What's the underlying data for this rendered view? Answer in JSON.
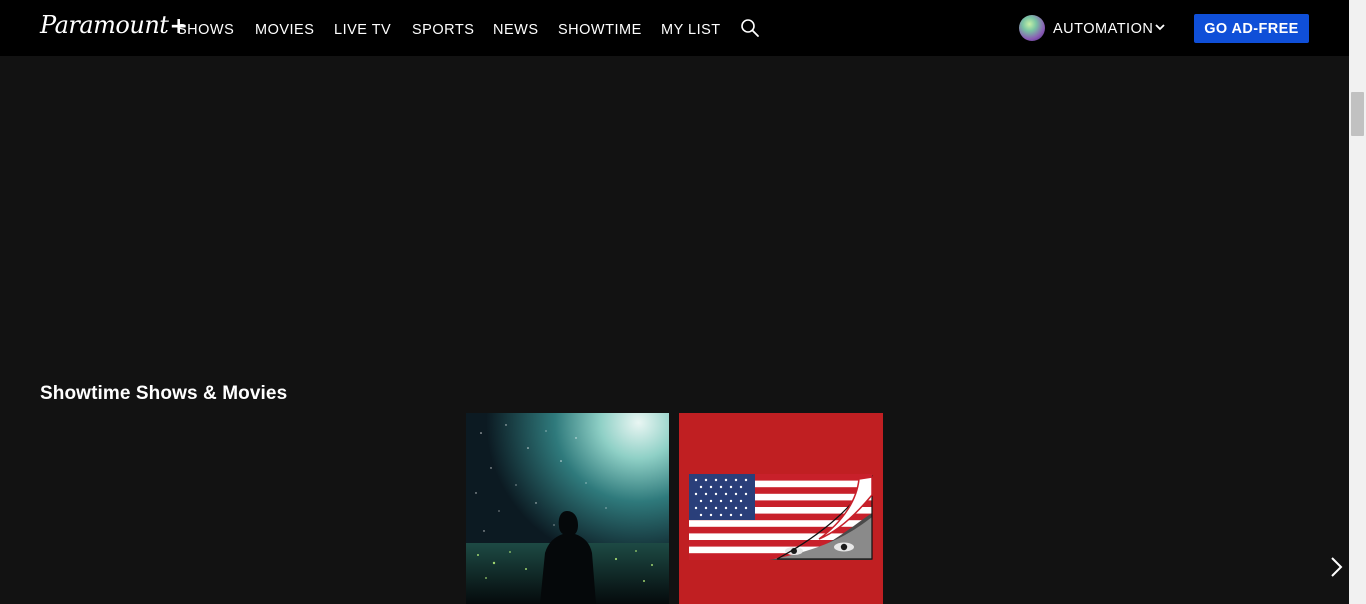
{
  "header": {
    "logo_text": "Paramount",
    "logo_plus": "+",
    "nav_items": [
      "SHOWS",
      "MOVIES",
      "LIVE TV",
      "SPORTS",
      "NEWS",
      "SHOWTIME",
      "MY LIST"
    ],
    "search_icon": "search-icon",
    "profile_name": "AUTOMATION",
    "profile_chevron_icon": "chevron-down-icon",
    "ad_free_button": "GO AD-FREE",
    "ad_free_color": "#0f4fd8"
  },
  "main": {
    "section_title": "Showtime Shows & Movies",
    "tiles": [
      {
        "art": "night-sky-silhouette-poster"
      },
      {
        "art": "american-flag-eyes-poster",
        "background": "#c01f22"
      }
    ],
    "next_icon": "chevron-right-icon"
  },
  "colors": {
    "page_background": "#121212",
    "nav_background": "#000000"
  }
}
